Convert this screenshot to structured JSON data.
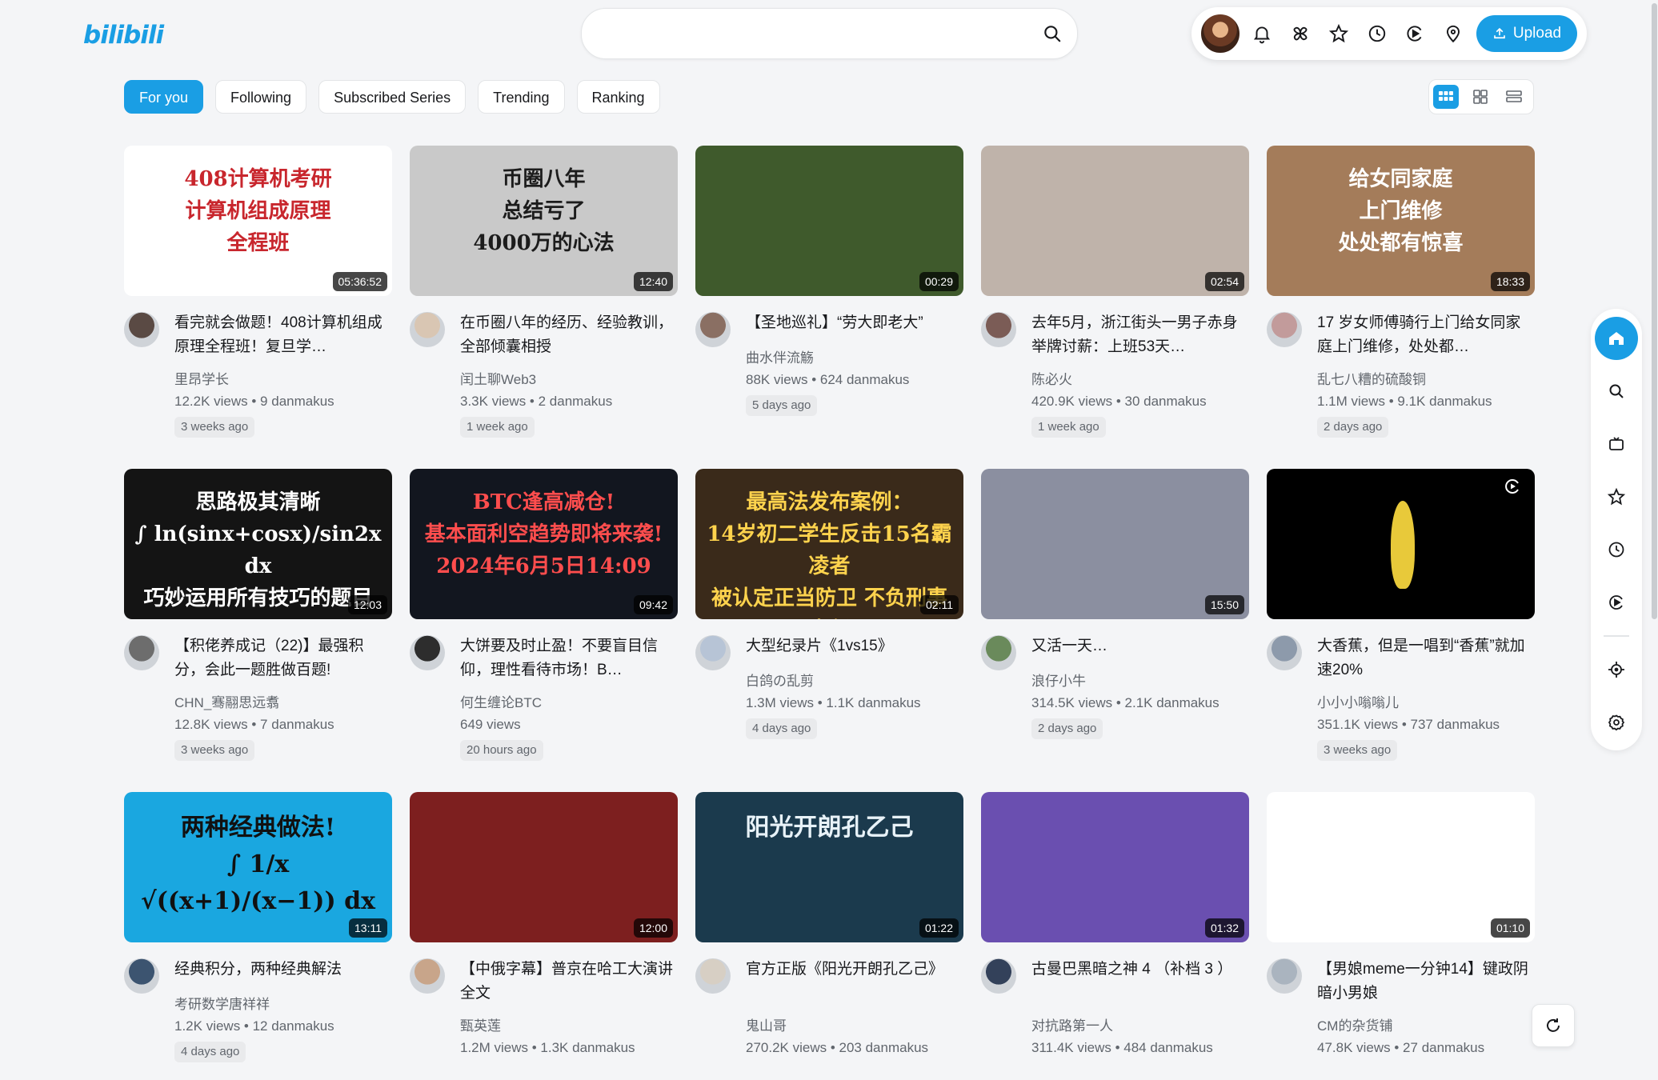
{
  "header": {
    "logo": "bilibili",
    "search_placeholder": "",
    "upload_label": "Upload"
  },
  "tabs": [
    {
      "label": "For you",
      "active": true
    },
    {
      "label": "Following"
    },
    {
      "label": "Subscribed Series"
    },
    {
      "label": "Trending"
    },
    {
      "label": "Ranking"
    }
  ],
  "videos": [
    {
      "title": "看完就会做题！408计算机组成原理全程班！复旦学…",
      "author": "里昂学长",
      "stats": "12.2K views • 9 danmakus",
      "age": "3 weeks ago",
      "duration": "05:36:52",
      "thumb_text": "408计算机考研\n计算机组成原理\n全程班",
      "thumb_bg": "#ffffff",
      "thumb_fg": "#c8262d"
    },
    {
      "title": "在币圈八年的经历、经验教训，全部倾囊相授",
      "author": "闰土聊Web3",
      "stats": "3.3K views • 2 danmakus",
      "age": "1 week ago",
      "duration": "12:40",
      "thumb_text": "币圈八年\n总结亏了\n4000万的心法",
      "thumb_bg": "#c9c9c9",
      "thumb_fg": "#1c1c1c"
    },
    {
      "title": "【圣地巡礼】“劳大即老大”",
      "author": "曲水伴流觞",
      "stats": "88K views • 624 danmakus",
      "age": "5 days ago",
      "duration": "00:29",
      "thumb_text": "",
      "thumb_bg": "#3f5a2c",
      "thumb_fg": "#ffffff"
    },
    {
      "title": "去年5月，浙江街头一男子赤身举牌讨薪：上班53天…",
      "author": "陈必火",
      "stats": "420.9K views • 30 danmakus",
      "age": "1 week ago",
      "duration": "02:54",
      "thumb_text": "",
      "thumb_bg": "#bfb3aa",
      "thumb_fg": "#ffffff"
    },
    {
      "title": "17 岁女师傅骑行上门给女同家庭上门维修，处处都…",
      "author": "乱七八糟的硫酸铜",
      "stats": "1.1M views • 9.1K danmakus",
      "age": "2 days ago",
      "duration": "18:33",
      "thumb_text": "给女同家庭\n上门维修\n处处都有惊喜",
      "thumb_bg": "#a47c5a",
      "thumb_fg": "#ffffff"
    },
    {
      "title": "【积佬养成记（22)】最强积分，会此一题胜做百题!",
      "author": "CHN_骞翮思远翥",
      "stats": "12.8K views • 7 danmakus",
      "age": "3 weeks ago",
      "duration": "12:03",
      "thumb_text": "思路极其清晰\n∫ ln(sinx+cosx)/sin2x dx\n巧妙运用所有技巧的题目",
      "thumb_bg": "#141414",
      "thumb_fg": "#ffffff"
    },
    {
      "title": "大饼要及时止盈！不要盲目信仰，理性看待市场！B…",
      "author": "何生缠论BTC",
      "stats": "649 views",
      "age": "20 hours ago",
      "duration": "09:42",
      "thumb_text": "BTC逢高减仓!\n基本面利空趋势即将来袭!\n2024年6月5日14:09",
      "thumb_bg": "#12161f",
      "thumb_fg": "#ff4d4d"
    },
    {
      "title": "大型纪录片《1vs15》",
      "author": "白鸽の乱剪",
      "stats": "1.3M views • 1.1K danmakus",
      "age": "4 days ago",
      "duration": "02:11",
      "thumb_text": "最高法发布案例：\n14岁初二学生反击15名霸凌者\n被认定正当防卫 不负刑事责任",
      "thumb_bg": "#3a2a1a",
      "thumb_fg": "#ffd34d"
    },
    {
      "title": "又活一天…",
      "author": "浪仔小牛",
      "stats": "314.5K views • 2.1K danmakus",
      "age": "2 days ago",
      "duration": "15:50",
      "thumb_text": "",
      "thumb_bg": "#8b8fa0",
      "thumb_fg": "#ffffff"
    },
    {
      "title": "大香蕉，但是一唱到“香蕉”就加速20%",
      "author": "小小小嗡嗡儿",
      "stats": "351.1K views • 737 danmakus",
      "age": "3 weeks ago",
      "duration": "",
      "thumb_text": "",
      "thumb_bg": "#000000",
      "thumb_fg": "#ffffff"
    },
    {
      "title": "经典积分，两种经典解法",
      "author": "考研数学唐祥祥",
      "stats": "1.2K views • 12 danmakus",
      "age": "4 days ago",
      "duration": "13:11",
      "thumb_text": "两种经典做法!\n∫ 1/x √((x+1)/(x−1)) dx",
      "thumb_bg": "#1aa7e0",
      "thumb_fg": "#111111"
    },
    {
      "title": "【中俄字幕】普京在哈工大演讲全文",
      "author": "甄英莲",
      "stats": "1.2M views • 1.3K danmakus",
      "age": "",
      "duration": "12:00",
      "thumb_text": "",
      "thumb_bg": "#7d1f1f",
      "thumb_fg": "#f7d87a"
    },
    {
      "title": "官方正版《阳光开朗孔乙己》",
      "author": "鬼山哥",
      "stats": "270.2K views • 203 danmakus",
      "age": "",
      "duration": "01:22",
      "thumb_text": "阳光开朗孔乙己",
      "thumb_bg": "#1b3a4d",
      "thumb_fg": "#e8f2f8"
    },
    {
      "title": "古曼巴黑暗之神 4 （补档 3 ）",
      "author": "对抗路第一人",
      "stats": "311.4K views • 484 danmakus",
      "age": "",
      "duration": "01:32",
      "thumb_text": "",
      "thumb_bg": "#6a4fb0",
      "thumb_fg": "#ffffff"
    },
    {
      "title": "【男娘meme一分钟14】键政阴暗小男娘",
      "author": "CM的杂货铺",
      "stats": "47.8K views • 27 danmakus",
      "age": "",
      "duration": "01:10",
      "thumb_text": "",
      "thumb_bg": "#ffffff",
      "thumb_fg": "#111111"
    }
  ],
  "rail_icons": [
    "home-icon",
    "search-icon",
    "tv-icon",
    "star-icon",
    "history-icon",
    "replay-icon",
    "locate-icon",
    "settings-icon"
  ],
  "colors": {
    "accent": "#1a9ee4",
    "background": "#f4f5f7"
  }
}
